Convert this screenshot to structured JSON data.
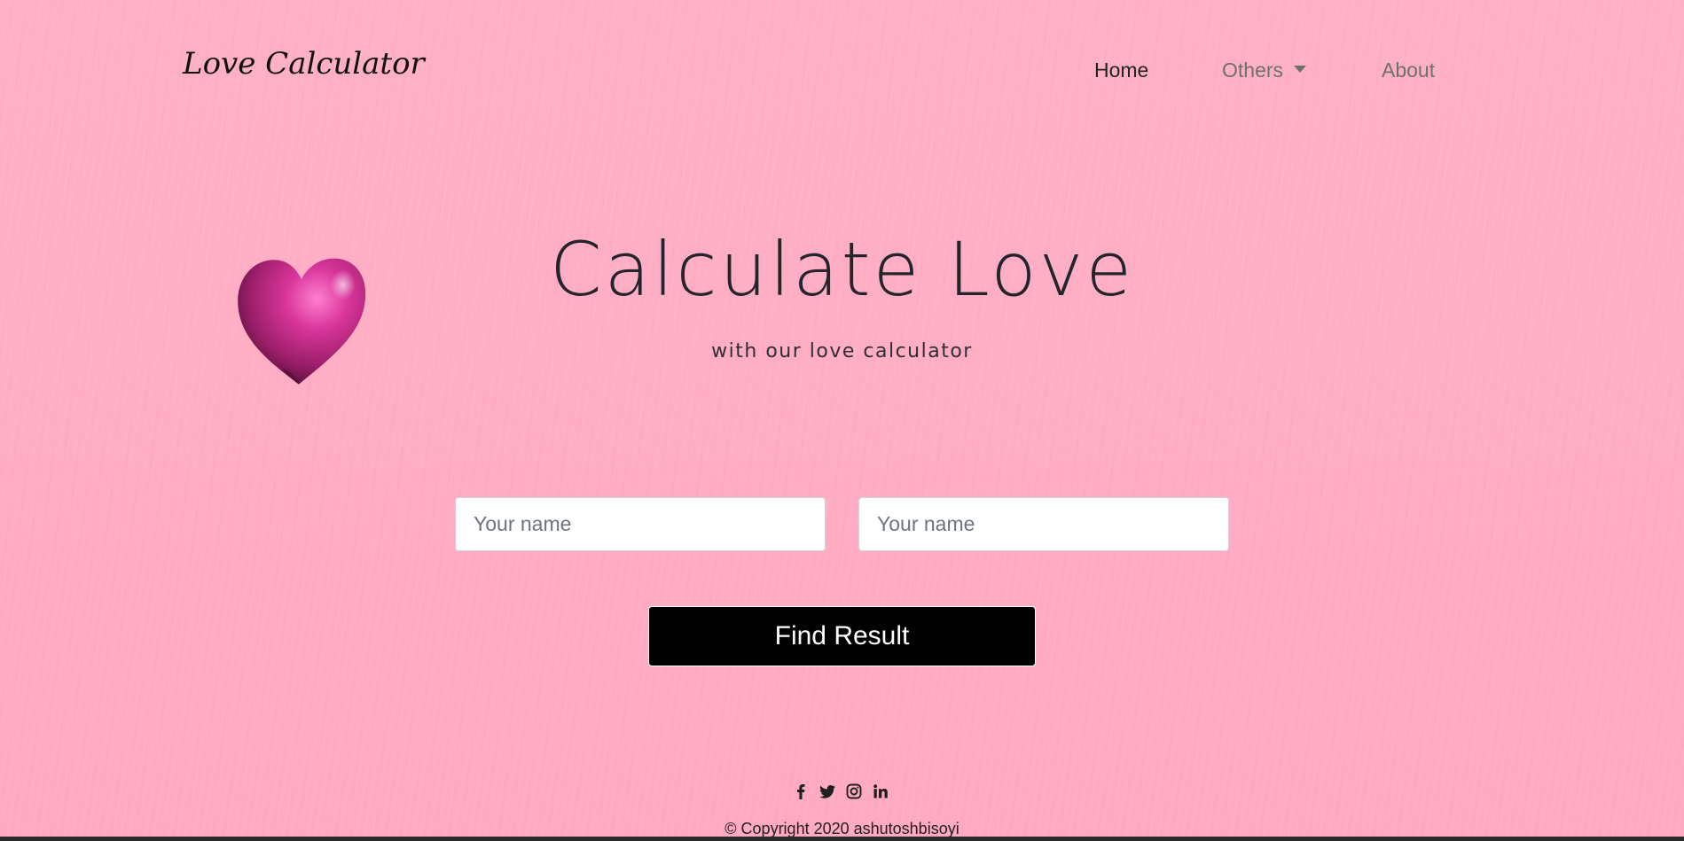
{
  "navbar": {
    "brand": "Love Calculator",
    "links": [
      {
        "label": "Home"
      },
      {
        "label": "Others"
      },
      {
        "label": "About"
      }
    ]
  },
  "hero": {
    "title": "Calculate Love",
    "subtitle": "with our love calculator"
  },
  "form": {
    "name1_placeholder": "Your name",
    "name2_placeholder": "Your name",
    "submit_label": "Find Result"
  },
  "footer": {
    "social_icons": [
      "facebook-icon",
      "twitter-icon",
      "instagram-icon",
      "linkedin-icon"
    ],
    "copyright": "© Copyright 2020 ashutoshbisoyi"
  },
  "colors": {
    "background": "#ffadc4",
    "button": "#000000",
    "heart": "#b5246f"
  }
}
